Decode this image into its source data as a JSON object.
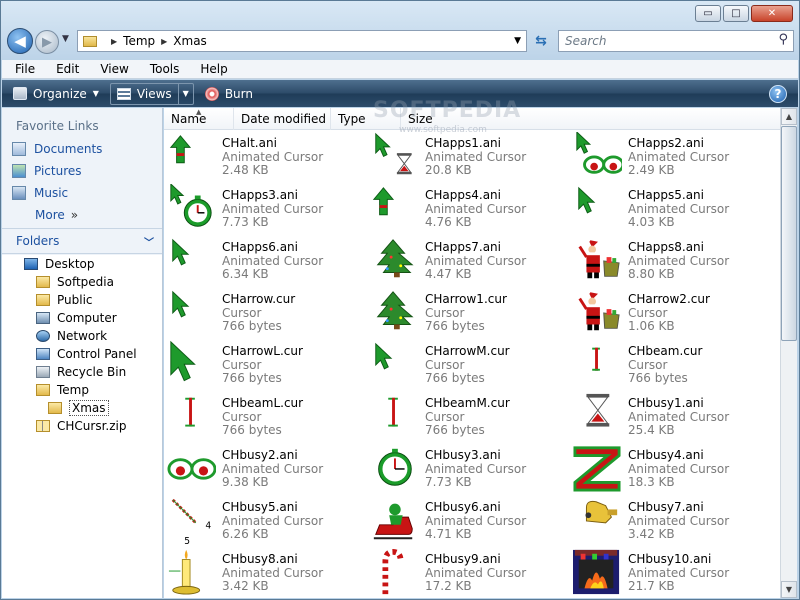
{
  "window": {
    "minimize": "▭",
    "maximize": "□",
    "close": "✕"
  },
  "nav": {
    "back_icon": "arrow-left-icon",
    "breadcrumb": [
      "Temp",
      "Xmas"
    ],
    "search_placeholder": "Search"
  },
  "menu": [
    "File",
    "Edit",
    "View",
    "Tools",
    "Help"
  ],
  "toolbar": {
    "organize": "Organize",
    "views": "Views",
    "burn": "Burn",
    "help": "?"
  },
  "sidebar": {
    "favorite_title": "Favorite Links",
    "links": [
      "Documents",
      "Pictures",
      "Music"
    ],
    "more": "More",
    "more_chev": "»",
    "folders_title": "Folders",
    "tree": [
      {
        "label": "Desktop",
        "level": 0,
        "icon": "desktop"
      },
      {
        "label": "Softpedia",
        "level": 1,
        "icon": "user-folder"
      },
      {
        "label": "Public",
        "level": 1,
        "icon": "folder"
      },
      {
        "label": "Computer",
        "level": 1,
        "icon": "computer"
      },
      {
        "label": "Network",
        "level": 1,
        "icon": "network"
      },
      {
        "label": "Control Panel",
        "level": 1,
        "icon": "control-panel"
      },
      {
        "label": "Recycle Bin",
        "level": 1,
        "icon": "recycle-bin"
      },
      {
        "label": "Temp",
        "level": 1,
        "icon": "folder"
      },
      {
        "label": "Xmas",
        "level": 2,
        "icon": "folder",
        "selected": true
      },
      {
        "label": "CHCursr.zip",
        "level": 1,
        "icon": "zip"
      }
    ]
  },
  "columns": [
    "Name",
    "Date modified",
    "Type",
    "Size"
  ],
  "watermark": {
    "text": "SOFTPEDIA",
    "sub": "www.softpedia.com"
  },
  "files": [
    {
      "name": "CHalt.ani",
      "type": "Animated Cursor",
      "size": "2.48 KB",
      "icon": "arrow-up-green"
    },
    {
      "name": "CHapps1.ani",
      "type": "Animated Cursor",
      "size": "20.8 KB",
      "icon": "arrow-hourglass"
    },
    {
      "name": "CHapps2.ani",
      "type": "Animated Cursor",
      "size": "2.49 KB",
      "icon": "arrow-eyes"
    },
    {
      "name": "CHapps3.ani",
      "type": "Animated Cursor",
      "size": "7.73 KB",
      "icon": "arrow-clock"
    },
    {
      "name": "CHapps4.ani",
      "type": "Animated Cursor",
      "size": "4.76 KB",
      "icon": "arrow-up-green"
    },
    {
      "name": "CHapps5.ani",
      "type": "Animated Cursor",
      "size": "4.03 KB",
      "icon": "arrow-green"
    },
    {
      "name": "CHapps6.ani",
      "type": "Animated Cursor",
      "size": "6.34 KB",
      "icon": "arrow-green"
    },
    {
      "name": "CHapps7.ani",
      "type": "Animated Cursor",
      "size": "4.47 KB",
      "icon": "tree"
    },
    {
      "name": "CHapps8.ani",
      "type": "Animated Cursor",
      "size": "8.80 KB",
      "icon": "santa"
    },
    {
      "name": "CHarrow.cur",
      "type": "Cursor",
      "size": "766 bytes",
      "icon": "arrow-green"
    },
    {
      "name": "CHarrow1.cur",
      "type": "Cursor",
      "size": "766 bytes",
      "icon": "tree"
    },
    {
      "name": "CHarrow2.cur",
      "type": "Cursor",
      "size": "1.06 KB",
      "icon": "santa"
    },
    {
      "name": "CHarrowL.cur",
      "type": "Cursor",
      "size": "766 bytes",
      "icon": "arrow-green-large"
    },
    {
      "name": "CHarrowM.cur",
      "type": "Cursor",
      "size": "766 bytes",
      "icon": "arrow-green"
    },
    {
      "name": "CHbeam.cur",
      "type": "Cursor",
      "size": "766 bytes",
      "icon": "ibeam-small"
    },
    {
      "name": "CHbeamL.cur",
      "type": "Cursor",
      "size": "766 bytes",
      "icon": "ibeam"
    },
    {
      "name": "CHbeamM.cur",
      "type": "Cursor",
      "size": "766 bytes",
      "icon": "ibeam"
    },
    {
      "name": "CHbusy1.ani",
      "type": "Animated Cursor",
      "size": "25.4 KB",
      "icon": "hourglass"
    },
    {
      "name": "CHbusy2.ani",
      "type": "Animated Cursor",
      "size": "9.38 KB",
      "icon": "eyes"
    },
    {
      "name": "CHbusy3.ani",
      "type": "Animated Cursor",
      "size": "7.73 KB",
      "icon": "clock"
    },
    {
      "name": "CHbusy4.ani",
      "type": "Animated Cursor",
      "size": "18.3 KB",
      "icon": "zigzag"
    },
    {
      "name": "CHbusy5.ani",
      "type": "Animated Cursor",
      "size": "6.26 KB",
      "icon": "countdown"
    },
    {
      "name": "CHbusy6.ani",
      "type": "Animated Cursor",
      "size": "4.71 KB",
      "icon": "sleigh"
    },
    {
      "name": "CHbusy7.ani",
      "type": "Animated Cursor",
      "size": "3.42 KB",
      "icon": "bell"
    },
    {
      "name": "CHbusy8.ani",
      "type": "Animated Cursor",
      "size": "3.42 KB",
      "icon": "candle"
    },
    {
      "name": "CHbusy9.ani",
      "type": "Animated Cursor",
      "size": "17.2 KB",
      "icon": "candy-cane"
    },
    {
      "name": "CHbusy10.ani",
      "type": "Animated Cursor",
      "size": "21.7 KB",
      "icon": "fireplace"
    }
  ],
  "countdown_digits": [
    "4",
    "5"
  ]
}
